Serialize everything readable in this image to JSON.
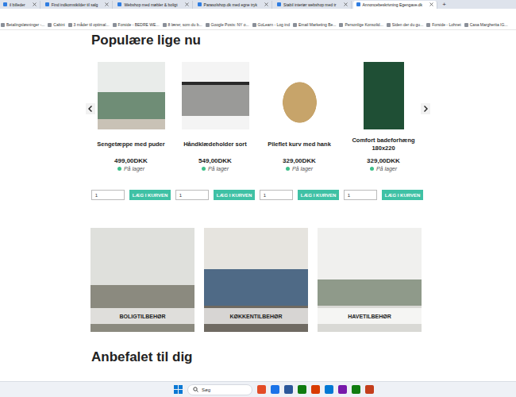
{
  "browser": {
    "tabs": [
      {
        "label": "il billeder",
        "selected": false
      },
      {
        "label": "Find indkomstkilder til salg",
        "selected": false
      },
      {
        "label": "Webshop med møbler & boligt",
        "selected": false
      },
      {
        "label": "Parasolshop.dk med egne tryk",
        "selected": false
      },
      {
        "label": "Stabil interiør webshop med tr",
        "selected": false
      },
      {
        "label": "Annoncebeskrivning Egengave.dk",
        "selected": true
      }
    ],
    "new_tab": "+",
    "bookmarks": [
      "Betalingsløsninger -...",
      "Cabini",
      "3 måder til optimal...",
      "Forside - BEDRE WE...",
      "8 lærer, som du b...",
      "Google Posts: NY o...",
      "GoLearn - Log ind",
      "Email Marketing Be...",
      "Personlige Konsolid...",
      "Siden der du gu...",
      "Forside - Lohnet",
      "Casa Margherita IG..."
    ]
  },
  "page": {
    "popular": {
      "title": "Populære lige nu",
      "products": [
        {
          "name": "Sengetæppe med puder",
          "price": "499,00DKK",
          "stock": "På lager",
          "in_stock": true,
          "quantity": "1",
          "button": "LÆG I KURVEN"
        },
        {
          "name": "Håndklædeholder sort",
          "price": "549,00DKK",
          "stock": "På lager",
          "in_stock": true,
          "quantity": "1",
          "button": "LÆG I KURVEN"
        },
        {
          "name": "Pileflet kurv med hank",
          "price": "329,00DKK",
          "stock": "På lager",
          "in_stock": true,
          "quantity": "1",
          "button": "LÆG I KURVEN"
        },
        {
          "name": "Comfort badeforhæng 180x220",
          "price": "329,00DKK",
          "stock": "På lager",
          "in_stock": true,
          "quantity": "1",
          "button": "LÆG I KURVEN"
        }
      ]
    },
    "categories": [
      {
        "label": "BOLIGTILBEHØR"
      },
      {
        "label": "KØKKENTILBEHØR"
      },
      {
        "label": "HAVETILBEHØR"
      }
    ],
    "recommended": {
      "title": "Anbefalet til dig"
    }
  },
  "taskbar": {
    "search": {
      "placeholder": "Søg"
    }
  }
}
